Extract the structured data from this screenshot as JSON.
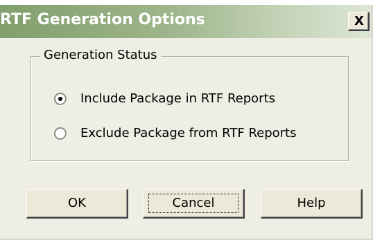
{
  "window": {
    "title": "RTF Generation Options",
    "close_label": "X"
  },
  "group": {
    "legend": "Generation Status",
    "options": [
      {
        "label": "Include Package in RTF Reports",
        "selected": true
      },
      {
        "label": "Exclude Package from RTF Reports",
        "selected": false
      }
    ]
  },
  "buttons": {
    "ok": "OK",
    "cancel": "Cancel",
    "help": "Help"
  }
}
